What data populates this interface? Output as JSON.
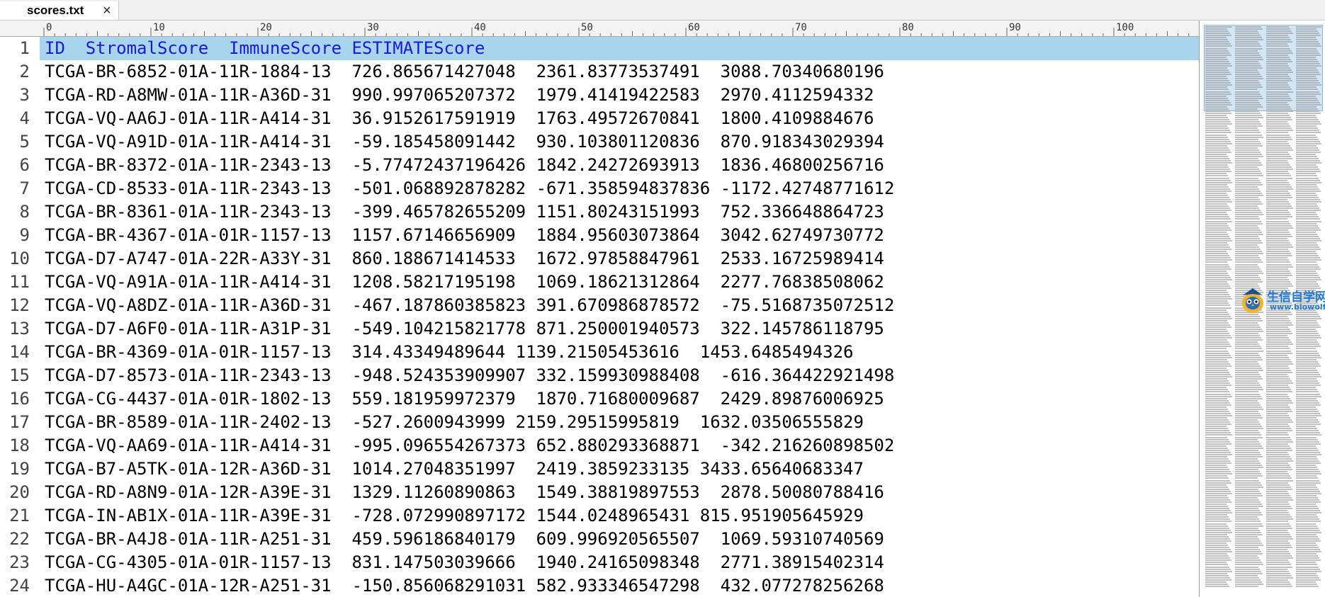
{
  "tab": {
    "title": "scores.txt",
    "close_glyph": "×"
  },
  "ruler": {
    "labels": [
      "0",
      "10",
      "20",
      "30",
      "40",
      "50",
      "60",
      "70",
      "80",
      "90",
      "100"
    ]
  },
  "lines": [
    {
      "n": "1",
      "text": "ID  StromalScore  ImmuneScore ESTIMATEScore",
      "highlight": true
    },
    {
      "n": "2",
      "text": "TCGA-BR-6852-01A-11R-1884-13  726.865671427048  2361.83773537491  3088.70340680196"
    },
    {
      "n": "3",
      "text": "TCGA-RD-A8MW-01A-11R-A36D-31  990.997065207372  1979.41419422583  2970.4112594332"
    },
    {
      "n": "4",
      "text": "TCGA-VQ-AA6J-01A-11R-A414-31  36.9152617591919  1763.49572670841  1800.4109884676"
    },
    {
      "n": "5",
      "text": "TCGA-VQ-A91D-01A-11R-A414-31  -59.185458091442  930.103801120836  870.918343029394"
    },
    {
      "n": "6",
      "text": "TCGA-BR-8372-01A-11R-2343-13  -5.77472437196426 1842.24272693913  1836.46800256716"
    },
    {
      "n": "7",
      "text": "TCGA-CD-8533-01A-11R-2343-13  -501.068892878282 -671.358594837836 -1172.42748771612"
    },
    {
      "n": "8",
      "text": "TCGA-BR-8361-01A-11R-2343-13  -399.465782655209 1151.80243151993  752.336648864723"
    },
    {
      "n": "9",
      "text": "TCGA-BR-4367-01A-01R-1157-13  1157.67146656909  1884.95603073864  3042.62749730772"
    },
    {
      "n": "10",
      "text": "TCGA-D7-A747-01A-22R-A33Y-31  860.188671414533  1672.97858847961  2533.16725989414"
    },
    {
      "n": "11",
      "text": "TCGA-VQ-A91A-01A-11R-A414-31  1208.58217195198  1069.18621312864  2277.76838508062"
    },
    {
      "n": "12",
      "text": "TCGA-VQ-A8DZ-01A-11R-A36D-31  -467.187860385823 391.670986878572  -75.5168735072512"
    },
    {
      "n": "13",
      "text": "TCGA-D7-A6F0-01A-11R-A31P-31  -549.104215821778 871.250001940573  322.145786118795"
    },
    {
      "n": "14",
      "text": "TCGA-BR-4369-01A-01R-1157-13  314.43349489644 1139.21505453616  1453.6485494326"
    },
    {
      "n": "15",
      "text": "TCGA-D7-8573-01A-11R-2343-13  -948.524353909907 332.159930988408  -616.364422921498"
    },
    {
      "n": "16",
      "text": "TCGA-CG-4437-01A-01R-1802-13  559.181959972379  1870.71680009687  2429.89876006925"
    },
    {
      "n": "17",
      "text": "TCGA-BR-8589-01A-11R-2402-13  -527.2600943999 2159.29515995819  1632.03506555829"
    },
    {
      "n": "18",
      "text": "TCGA-VQ-AA69-01A-11R-A414-31  -995.096554267373 652.880293368871  -342.216260898502"
    },
    {
      "n": "19",
      "text": "TCGA-B7-A5TK-01A-12R-A36D-31  1014.27048351997  2419.3859233135 3433.65640683347"
    },
    {
      "n": "20",
      "text": "TCGA-RD-A8N9-01A-12R-A39E-31  1329.11260890863  1549.38819897553  2878.50080788416"
    },
    {
      "n": "21",
      "text": "TCGA-IN-AB1X-01A-11R-A39E-31  -728.072990897172 1544.0248965431 815.951905645929"
    },
    {
      "n": "22",
      "text": "TCGA-BR-A4J8-01A-11R-A251-31  459.596186840179  609.996920565507  1069.59310740569"
    },
    {
      "n": "23",
      "text": "TCGA-CG-4305-01A-01R-1157-13  831.147503039666  1940.24165098348  2771.38915402314"
    },
    {
      "n": "24",
      "text": "TCGA-HU-A4GC-01A-12R-A251-31  -150.856068291031 582.933346547298  432.077278256268"
    }
  ],
  "watermark": {
    "line1": "生信自学网",
    "line2": "www.biowolf.cn"
  },
  "colors": {
    "highlight_bg": "#a8d4ee",
    "highlight_text": "#1a1ad6"
  }
}
